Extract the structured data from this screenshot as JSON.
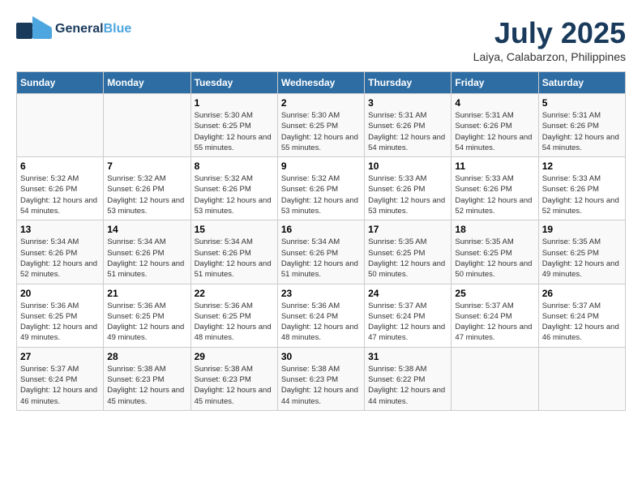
{
  "header": {
    "logo_general": "General",
    "logo_blue": "Blue",
    "month_year": "July 2025",
    "location": "Laiya, Calabarzon, Philippines"
  },
  "weekdays": [
    "Sunday",
    "Monday",
    "Tuesday",
    "Wednesday",
    "Thursday",
    "Friday",
    "Saturday"
  ],
  "weeks": [
    [
      {
        "day": "",
        "sunrise": "",
        "sunset": "",
        "daylight": ""
      },
      {
        "day": "",
        "sunrise": "",
        "sunset": "",
        "daylight": ""
      },
      {
        "day": "1",
        "sunrise": "Sunrise: 5:30 AM",
        "sunset": "Sunset: 6:25 PM",
        "daylight": "Daylight: 12 hours and 55 minutes."
      },
      {
        "day": "2",
        "sunrise": "Sunrise: 5:30 AM",
        "sunset": "Sunset: 6:25 PM",
        "daylight": "Daylight: 12 hours and 55 minutes."
      },
      {
        "day": "3",
        "sunrise": "Sunrise: 5:31 AM",
        "sunset": "Sunset: 6:26 PM",
        "daylight": "Daylight: 12 hours and 54 minutes."
      },
      {
        "day": "4",
        "sunrise": "Sunrise: 5:31 AM",
        "sunset": "Sunset: 6:26 PM",
        "daylight": "Daylight: 12 hours and 54 minutes."
      },
      {
        "day": "5",
        "sunrise": "Sunrise: 5:31 AM",
        "sunset": "Sunset: 6:26 PM",
        "daylight": "Daylight: 12 hours and 54 minutes."
      }
    ],
    [
      {
        "day": "6",
        "sunrise": "Sunrise: 5:32 AM",
        "sunset": "Sunset: 6:26 PM",
        "daylight": "Daylight: 12 hours and 54 minutes."
      },
      {
        "day": "7",
        "sunrise": "Sunrise: 5:32 AM",
        "sunset": "Sunset: 6:26 PM",
        "daylight": "Daylight: 12 hours and 53 minutes."
      },
      {
        "day": "8",
        "sunrise": "Sunrise: 5:32 AM",
        "sunset": "Sunset: 6:26 PM",
        "daylight": "Daylight: 12 hours and 53 minutes."
      },
      {
        "day": "9",
        "sunrise": "Sunrise: 5:32 AM",
        "sunset": "Sunset: 6:26 PM",
        "daylight": "Daylight: 12 hours and 53 minutes."
      },
      {
        "day": "10",
        "sunrise": "Sunrise: 5:33 AM",
        "sunset": "Sunset: 6:26 PM",
        "daylight": "Daylight: 12 hours and 53 minutes."
      },
      {
        "day": "11",
        "sunrise": "Sunrise: 5:33 AM",
        "sunset": "Sunset: 6:26 PM",
        "daylight": "Daylight: 12 hours and 52 minutes."
      },
      {
        "day": "12",
        "sunrise": "Sunrise: 5:33 AM",
        "sunset": "Sunset: 6:26 PM",
        "daylight": "Daylight: 12 hours and 52 minutes."
      }
    ],
    [
      {
        "day": "13",
        "sunrise": "Sunrise: 5:34 AM",
        "sunset": "Sunset: 6:26 PM",
        "daylight": "Daylight: 12 hours and 52 minutes."
      },
      {
        "day": "14",
        "sunrise": "Sunrise: 5:34 AM",
        "sunset": "Sunset: 6:26 PM",
        "daylight": "Daylight: 12 hours and 51 minutes."
      },
      {
        "day": "15",
        "sunrise": "Sunrise: 5:34 AM",
        "sunset": "Sunset: 6:26 PM",
        "daylight": "Daylight: 12 hours and 51 minutes."
      },
      {
        "day": "16",
        "sunrise": "Sunrise: 5:34 AM",
        "sunset": "Sunset: 6:26 PM",
        "daylight": "Daylight: 12 hours and 51 minutes."
      },
      {
        "day": "17",
        "sunrise": "Sunrise: 5:35 AM",
        "sunset": "Sunset: 6:25 PM",
        "daylight": "Daylight: 12 hours and 50 minutes."
      },
      {
        "day": "18",
        "sunrise": "Sunrise: 5:35 AM",
        "sunset": "Sunset: 6:25 PM",
        "daylight": "Daylight: 12 hours and 50 minutes."
      },
      {
        "day": "19",
        "sunrise": "Sunrise: 5:35 AM",
        "sunset": "Sunset: 6:25 PM",
        "daylight": "Daylight: 12 hours and 49 minutes."
      }
    ],
    [
      {
        "day": "20",
        "sunrise": "Sunrise: 5:36 AM",
        "sunset": "Sunset: 6:25 PM",
        "daylight": "Daylight: 12 hours and 49 minutes."
      },
      {
        "day": "21",
        "sunrise": "Sunrise: 5:36 AM",
        "sunset": "Sunset: 6:25 PM",
        "daylight": "Daylight: 12 hours and 49 minutes."
      },
      {
        "day": "22",
        "sunrise": "Sunrise: 5:36 AM",
        "sunset": "Sunset: 6:25 PM",
        "daylight": "Daylight: 12 hours and 48 minutes."
      },
      {
        "day": "23",
        "sunrise": "Sunrise: 5:36 AM",
        "sunset": "Sunset: 6:24 PM",
        "daylight": "Daylight: 12 hours and 48 minutes."
      },
      {
        "day": "24",
        "sunrise": "Sunrise: 5:37 AM",
        "sunset": "Sunset: 6:24 PM",
        "daylight": "Daylight: 12 hours and 47 minutes."
      },
      {
        "day": "25",
        "sunrise": "Sunrise: 5:37 AM",
        "sunset": "Sunset: 6:24 PM",
        "daylight": "Daylight: 12 hours and 47 minutes."
      },
      {
        "day": "26",
        "sunrise": "Sunrise: 5:37 AM",
        "sunset": "Sunset: 6:24 PM",
        "daylight": "Daylight: 12 hours and 46 minutes."
      }
    ],
    [
      {
        "day": "27",
        "sunrise": "Sunrise: 5:37 AM",
        "sunset": "Sunset: 6:24 PM",
        "daylight": "Daylight: 12 hours and 46 minutes."
      },
      {
        "day": "28",
        "sunrise": "Sunrise: 5:38 AM",
        "sunset": "Sunset: 6:23 PM",
        "daylight": "Daylight: 12 hours and 45 minutes."
      },
      {
        "day": "29",
        "sunrise": "Sunrise: 5:38 AM",
        "sunset": "Sunset: 6:23 PM",
        "daylight": "Daylight: 12 hours and 45 minutes."
      },
      {
        "day": "30",
        "sunrise": "Sunrise: 5:38 AM",
        "sunset": "Sunset: 6:23 PM",
        "daylight": "Daylight: 12 hours and 44 minutes."
      },
      {
        "day": "31",
        "sunrise": "Sunrise: 5:38 AM",
        "sunset": "Sunset: 6:22 PM",
        "daylight": "Daylight: 12 hours and 44 minutes."
      },
      {
        "day": "",
        "sunrise": "",
        "sunset": "",
        "daylight": ""
      },
      {
        "day": "",
        "sunrise": "",
        "sunset": "",
        "daylight": ""
      }
    ]
  ]
}
